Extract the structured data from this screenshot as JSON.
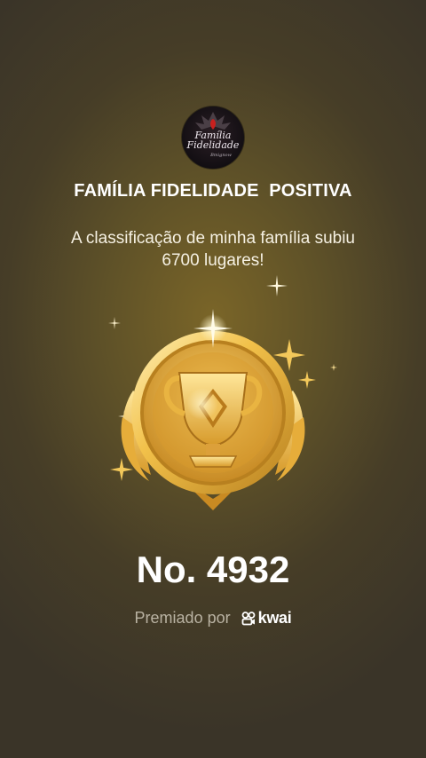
{
  "logo": {
    "line1": "Família",
    "line2": "Fidelidade",
    "line3": "Bmignow",
    "icon": "family-fidelity-logo"
  },
  "title": "FAMÍLIA FIDELIDADE  POSITIVA",
  "message": "A classificação de minha família subiu 6700 lugares!",
  "medal_icon": "trophy-medal-icon",
  "rank": "No. 4932",
  "award": {
    "text": "Premiado por",
    "brand": "kwai",
    "brand_icon": "kwai-logo-icon"
  },
  "colors": {
    "background": "#5e5128",
    "gold": "#e8b93c",
    "muted_text": "#b9b2a2"
  }
}
